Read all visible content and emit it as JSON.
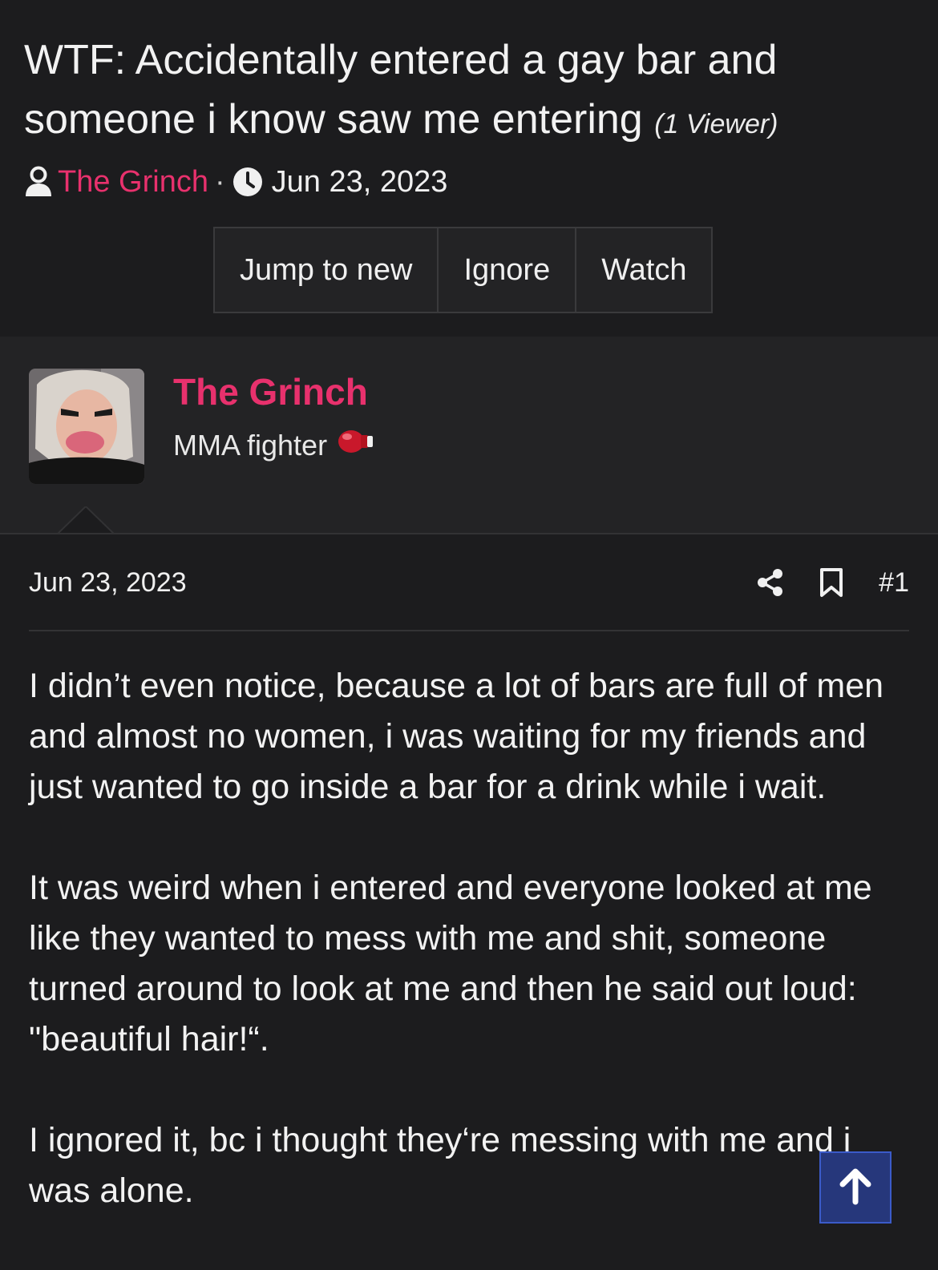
{
  "thread": {
    "title": "WTF: Accidentally entered a gay bar and someone i know saw me entering",
    "viewer_count": "(1 Viewer)",
    "author": "The Grinch",
    "separator": "·",
    "date": "Jun 23, 2023"
  },
  "buttons": {
    "jump_to_new": "Jump to new",
    "ignore": "Ignore",
    "watch": "Watch"
  },
  "post": {
    "username": "The Grinch",
    "user_title": "MMA fighter",
    "date": "Jun 23, 2023",
    "number": "#1",
    "paragraphs": [
      "I didn’t even notice, because a lot of bars are full of men and almost no women, i was waiting for my friends and just wanted to go inside a bar for a drink while i wait.",
      "It was weird when i entered and everyone looked at me like they wanted to mess with me and shit, someone turned around to look at me and then he said out loud: \"beautiful hair!“.",
      "I ignored it, bc i thought they‘re messing with me and i was alone."
    ]
  },
  "colors": {
    "accent": "#e8316d",
    "background": "#1c1c1e",
    "panel": "#232325",
    "scroll_button": "#2b3f8f"
  },
  "icons": {
    "user": "user-icon",
    "clock": "clock-icon",
    "share": "share-icon",
    "bookmark": "bookmark-icon",
    "boxing_glove": "boxing-glove-icon",
    "scroll_top": "arrow-up-icon"
  }
}
